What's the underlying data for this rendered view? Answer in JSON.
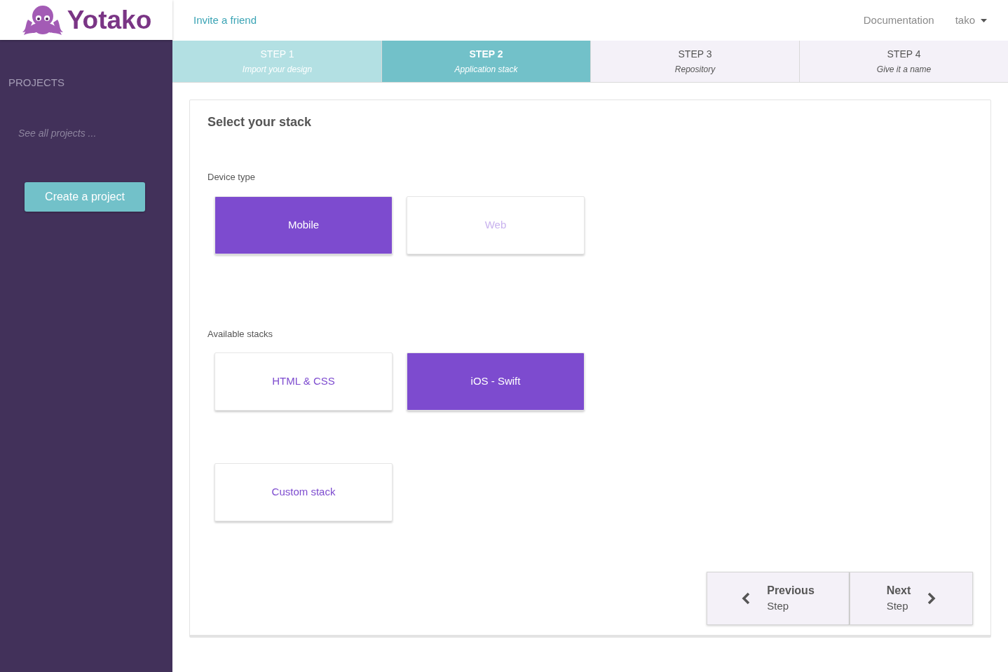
{
  "header": {
    "logo": "Yotako",
    "invite_link": "Invite a friend",
    "documentation_link": "Documentation",
    "user_menu": "tako"
  },
  "sidebar": {
    "heading": "PROJECTS",
    "see_all_link": "See all projects ...",
    "create_button": "Create a project"
  },
  "steps": [
    {
      "label": "STEP 1",
      "subtitle": "Import your design",
      "selected": false,
      "done": true
    },
    {
      "label": "STEP 2",
      "subtitle": "Application stack",
      "selected": true,
      "done": false
    },
    {
      "label": "STEP 3",
      "subtitle": "Repository",
      "selected": false,
      "done": false
    },
    {
      "label": "STEP 4",
      "subtitle": "Give it a name",
      "selected": false,
      "done": false
    }
  ],
  "card": {
    "title": "Select your stack",
    "device_type": {
      "label": "Device type",
      "options": [
        {
          "label": "Mobile",
          "selected": true,
          "disabled": false
        },
        {
          "label": "Web",
          "selected": false,
          "disabled": true
        }
      ]
    },
    "available_stacks": {
      "label": "Available stacks",
      "options": [
        {
          "label": "HTML & CSS",
          "selected": false,
          "disabled": false
        },
        {
          "label": "iOS - Swift",
          "selected": true,
          "disabled": false
        },
        {
          "label": "Custom stack",
          "selected": false,
          "disabled": false
        }
      ]
    },
    "navigation": {
      "previous": {
        "title": "Previous",
        "subtitle": "Step"
      },
      "next": {
        "title": "Next",
        "subtitle": "Step"
      }
    }
  }
}
